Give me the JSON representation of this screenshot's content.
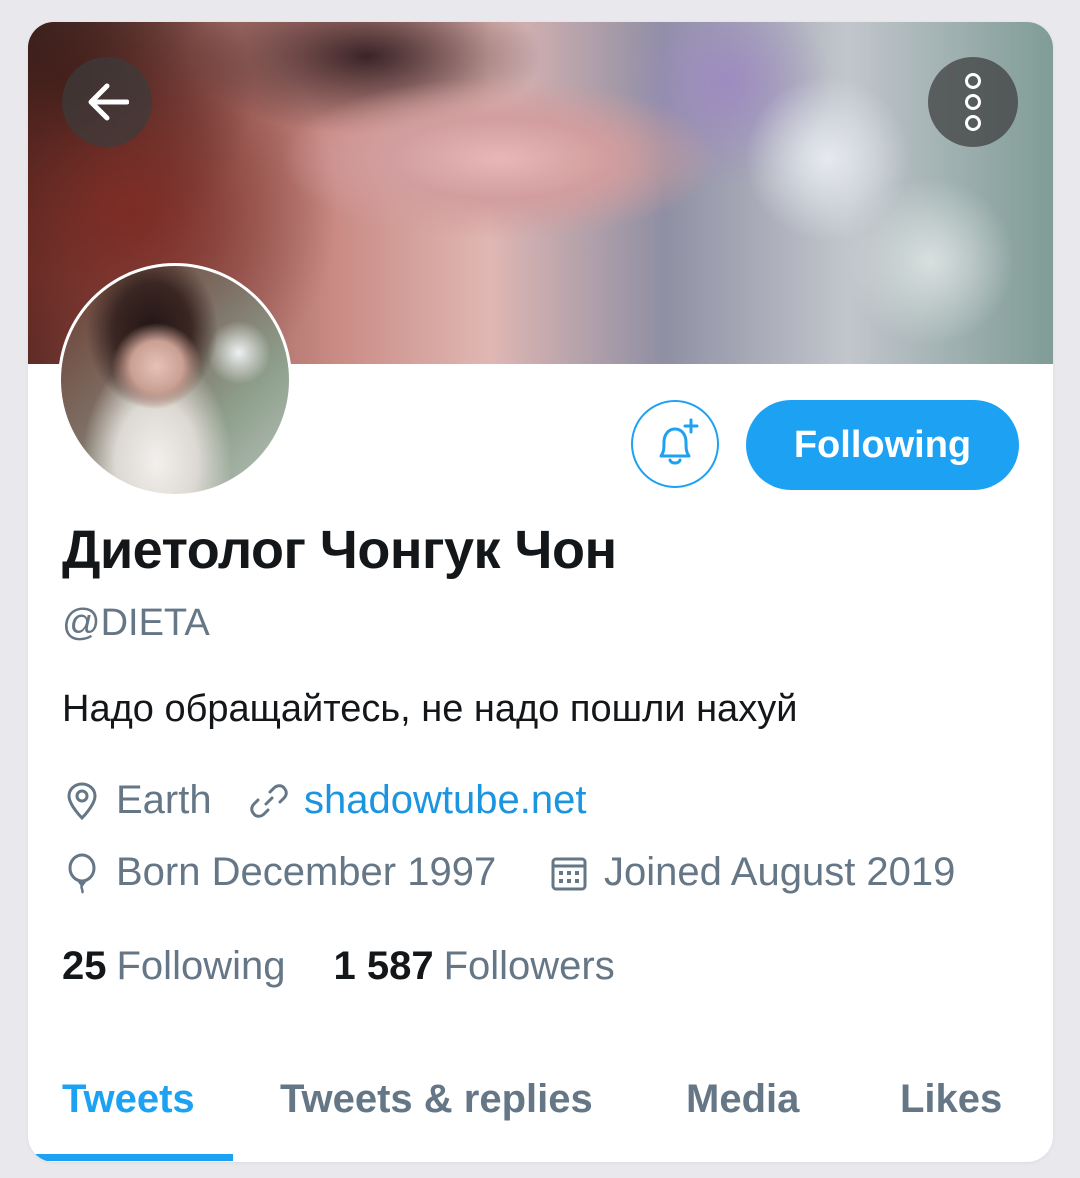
{
  "profile": {
    "name": "Диетолог Чонгук Чон",
    "handle": "@DIETA",
    "bio": "Надо обращайтесь, не надо пошли нахуй",
    "location": "Earth",
    "website": "shadowtube.net",
    "born": "Born December 1997",
    "joined": "Joined August 2019"
  },
  "actions": {
    "following_label": "Following",
    "bell_icon": "bell-plus-icon",
    "back_icon": "back-arrow-icon",
    "more_icon": "more-vertical-icon"
  },
  "stats": {
    "following_count": "25",
    "following_label": "Following",
    "followers_count": "1 587",
    "followers_label": "Followers"
  },
  "tabs": [
    {
      "label": "Tweets",
      "active": true
    },
    {
      "label": "Tweets & replies",
      "active": false
    },
    {
      "label": "Media",
      "active": false
    },
    {
      "label": "Likes",
      "active": false
    }
  ],
  "colors": {
    "accent": "#1da1f2",
    "link": "#1b95e0",
    "secondary_text": "#657786",
    "primary_text": "#14171a"
  }
}
